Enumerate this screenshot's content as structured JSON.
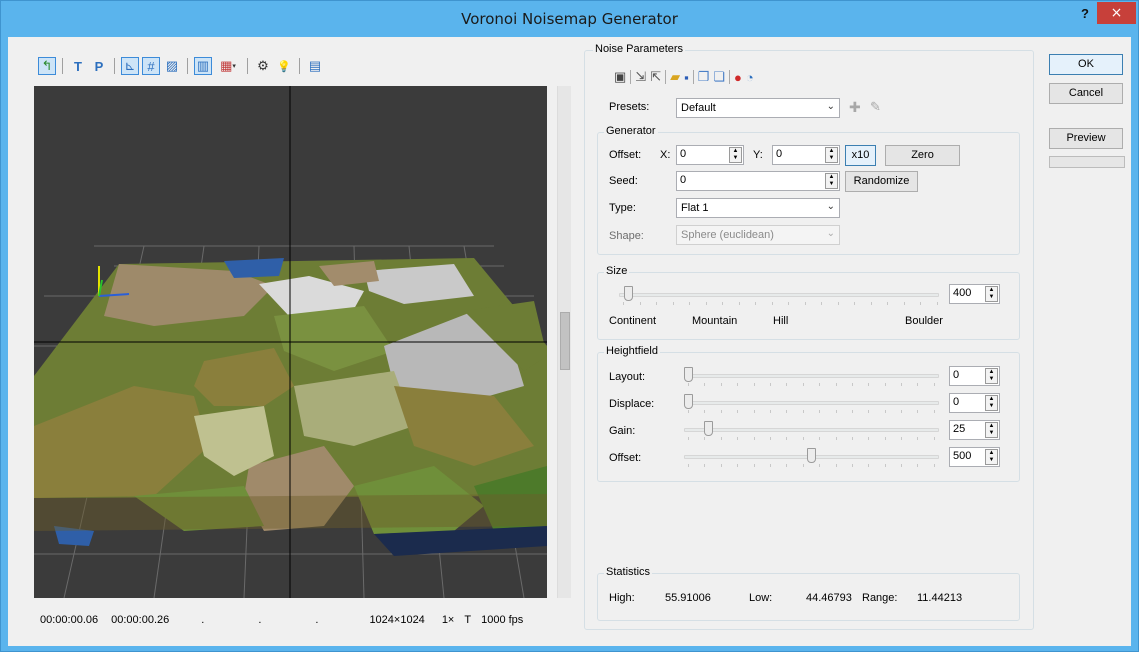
{
  "window": {
    "title": "Voronoi Noisemap Generator",
    "help": "?",
    "close": "×"
  },
  "viewer": {
    "toolbar_glyphs": [
      "↰",
      "T",
      "P",
      "⊾",
      "#",
      "▨",
      "▥",
      "▦",
      "⚙",
      "💡",
      "▤"
    ],
    "status": {
      "time1": "00:00:00.06",
      "time2": "00:00:00.26",
      "dot1": ".",
      "dot2": ".",
      "dot3": ".",
      "resolution": "1024×1024",
      "zoom": "1×",
      "mode": "T",
      "fps": "1000 fps"
    }
  },
  "noise": {
    "title": "Noise Parameters",
    "presets_label": "Presets:",
    "presets_value": "Default",
    "generator": {
      "title": "Generator",
      "offset_label": "Offset:",
      "x_label": "X:",
      "x_value": "0",
      "y_label": "Y:",
      "y_value": "0",
      "x10_label": "x10",
      "zero_label": "Zero",
      "seed_label": "Seed:",
      "seed_value": "0",
      "randomize_label": "Randomize",
      "type_label": "Type:",
      "type_value": "Flat 1",
      "shape_label": "Shape:",
      "shape_value": "Sphere  (euclidean)"
    },
    "size": {
      "title": "Size",
      "value": "400",
      "level": 0.02,
      "marks": [
        "Continent",
        "Mountain",
        "Hill",
        "Boulder"
      ]
    },
    "heightfield": {
      "title": "Heightfield",
      "rows": [
        {
          "label": "Layout:",
          "value": "0",
          "level": 0.0
        },
        {
          "label": "Displace:",
          "value": "0",
          "level": 0.0
        },
        {
          "label": "Gain:",
          "value": "25",
          "level": 0.08
        },
        {
          "label": "Offset:",
          "value": "500",
          "level": 0.5
        }
      ]
    },
    "statistics": {
      "title": "Statistics",
      "high_label": "High:",
      "high_value": "55.91006",
      "low_label": "Low:",
      "low_value": "44.46793",
      "range_label": "Range:",
      "range_value": "11.44213"
    }
  },
  "buttons": {
    "ok": "OK",
    "cancel": "Cancel",
    "preview": "Preview"
  },
  "colors": {
    "titlebar": "#5ab4ed",
    "close": "#c7403a",
    "viewport_bg": "#3b3b3b",
    "cell_olive": "#8a7f3c",
    "cell_green": "#6f8f3a",
    "cell_tan": "#a08a6a",
    "cell_white": "#d8d8d8",
    "water": "#2f5fa8"
  }
}
